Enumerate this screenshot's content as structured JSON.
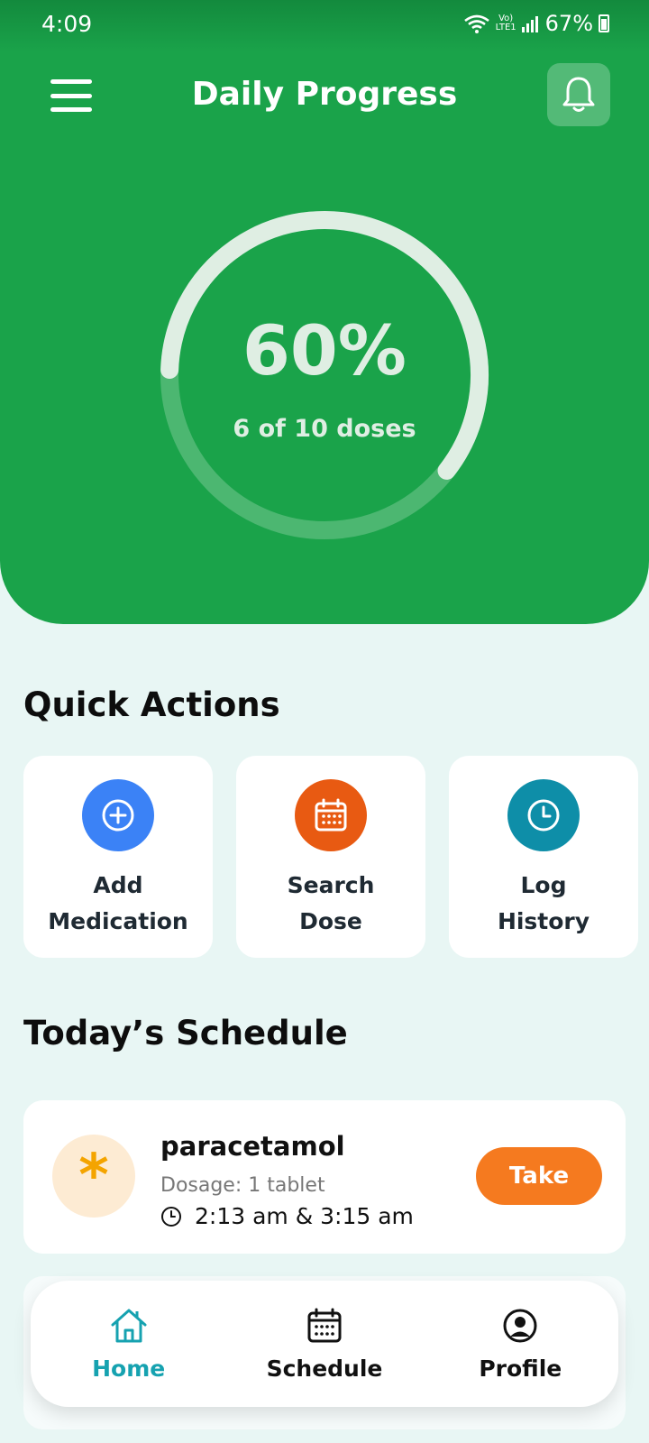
{
  "status": {
    "time": "4:09",
    "lte": "LTE1",
    "volte": "Vo)",
    "battery": "67%"
  },
  "header": {
    "title": "Daily Progress"
  },
  "progress": {
    "percent_label": "60%",
    "percent": 60,
    "subtitle": "6 of 10 doses"
  },
  "quick_actions": {
    "title": "Quick Actions",
    "items": [
      {
        "line1": "Add",
        "line2": "Medication",
        "color": "#3b82f6",
        "icon": "plus-circle-icon"
      },
      {
        "line1": "Search",
        "line2": "Dose",
        "color": "#e85a12",
        "icon": "calendar-icon"
      },
      {
        "line1": "Log",
        "line2": "History",
        "color": "#0e8ea8",
        "icon": "clock-icon"
      }
    ]
  },
  "schedule": {
    "title": "Today’s Schedule",
    "items": [
      {
        "name": "paracetamol",
        "dosage": "Dosage: 1 tablet",
        "time": "2:13 am & 3:15 am",
        "action": "Take"
      }
    ]
  },
  "nav": {
    "items": [
      {
        "label": "Home",
        "icon": "home-icon",
        "active": true
      },
      {
        "label": "Schedule",
        "icon": "calendar-icon",
        "active": false
      },
      {
        "label": "Profile",
        "icon": "profile-icon",
        "active": false
      }
    ]
  },
  "colors": {
    "primary": "#1aa34a",
    "accent_orange": "#f57a1f",
    "nav_active": "#16a2b0",
    "background": "#e8f6f4"
  }
}
